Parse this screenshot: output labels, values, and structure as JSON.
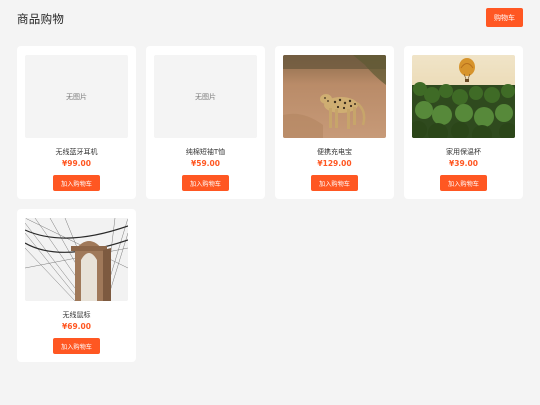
{
  "header": {
    "title": "商品购物",
    "cart_label": "购物车"
  },
  "products": [
    {
      "name": "无线蓝牙耳机",
      "price": "¥99.00",
      "image": "none",
      "no_image_label": "无图片",
      "add_label": "加入购物车"
    },
    {
      "name": "纯棉短袖T恤",
      "price": "¥59.00",
      "image": "none",
      "no_image_label": "无图片",
      "add_label": "加入购物车"
    },
    {
      "name": "便携充电宝",
      "price": "¥129.00",
      "image": "leopard-photo",
      "add_label": "加入购物车"
    },
    {
      "name": "家用保温杯",
      "price": "¥39.00",
      "image": "hot-air-balloon-photo",
      "add_label": "加入购物车"
    },
    {
      "name": "无线鼠标",
      "price": "¥69.00",
      "image": "bridge-photo",
      "add_label": "加入购物车"
    }
  ],
  "colors": {
    "accent": "#ff5722",
    "background": "#f4f4f4",
    "card": "#ffffff"
  }
}
